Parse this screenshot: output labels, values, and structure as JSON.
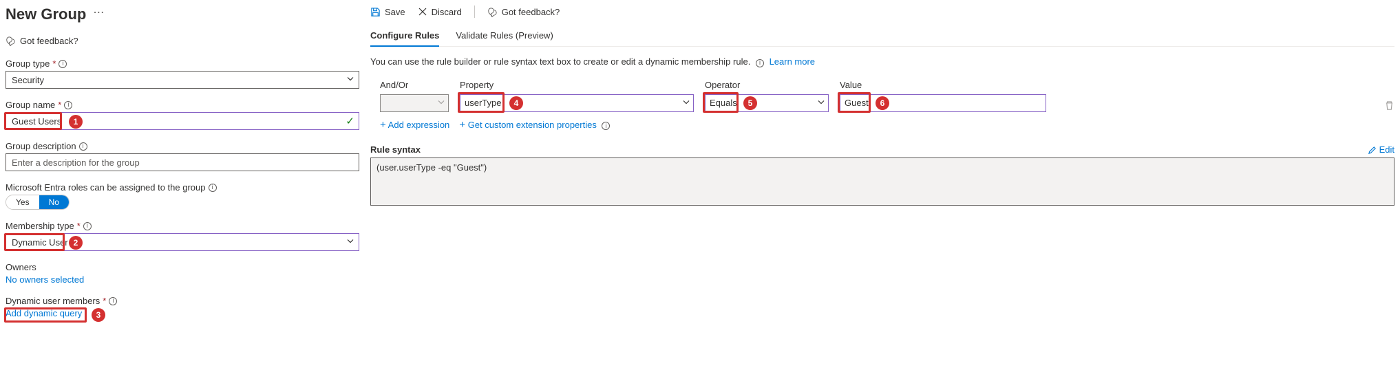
{
  "left": {
    "title": "New Group",
    "feedback": "Got feedback?",
    "group_type": {
      "label": "Group type",
      "value": "Security"
    },
    "group_name": {
      "label": "Group name",
      "value": "Guest  Users"
    },
    "group_desc": {
      "label": "Group description",
      "placeholder": "Enter a description for the group"
    },
    "entra_roles": {
      "label": "Microsoft Entra roles can be assigned to the group",
      "yes": "Yes",
      "no": "No"
    },
    "membership_type": {
      "label": "Membership type",
      "value": "Dynamic User"
    },
    "owners": {
      "label": "Owners",
      "value": "No owners selected"
    },
    "dyn_members": {
      "label": "Dynamic user members",
      "link": "Add dynamic query"
    }
  },
  "right": {
    "toolbar": {
      "save": "Save",
      "discard": "Discard",
      "feedback": "Got feedback?"
    },
    "tabs": {
      "configure": "Configure Rules",
      "validate": "Validate Rules (Preview)"
    },
    "hint": "You can use the rule builder or rule syntax text box to create or edit a dynamic membership rule.",
    "learn_more": "Learn more",
    "headers": {
      "andor": "And/Or",
      "property": "Property",
      "operator": "Operator",
      "value": "Value"
    },
    "row": {
      "property": "userType",
      "operator": "Equals",
      "value": "Guest"
    },
    "links": {
      "add_expr": "Add expression",
      "get_ext": "Get custom extension properties"
    },
    "rule_syntax": {
      "label": "Rule syntax",
      "edit": "Edit",
      "value": "(user.userType -eq \"Guest\")"
    }
  },
  "badges": {
    "b1": "1",
    "b2": "2",
    "b3": "3",
    "b4": "4",
    "b5": "5",
    "b6": "6"
  }
}
